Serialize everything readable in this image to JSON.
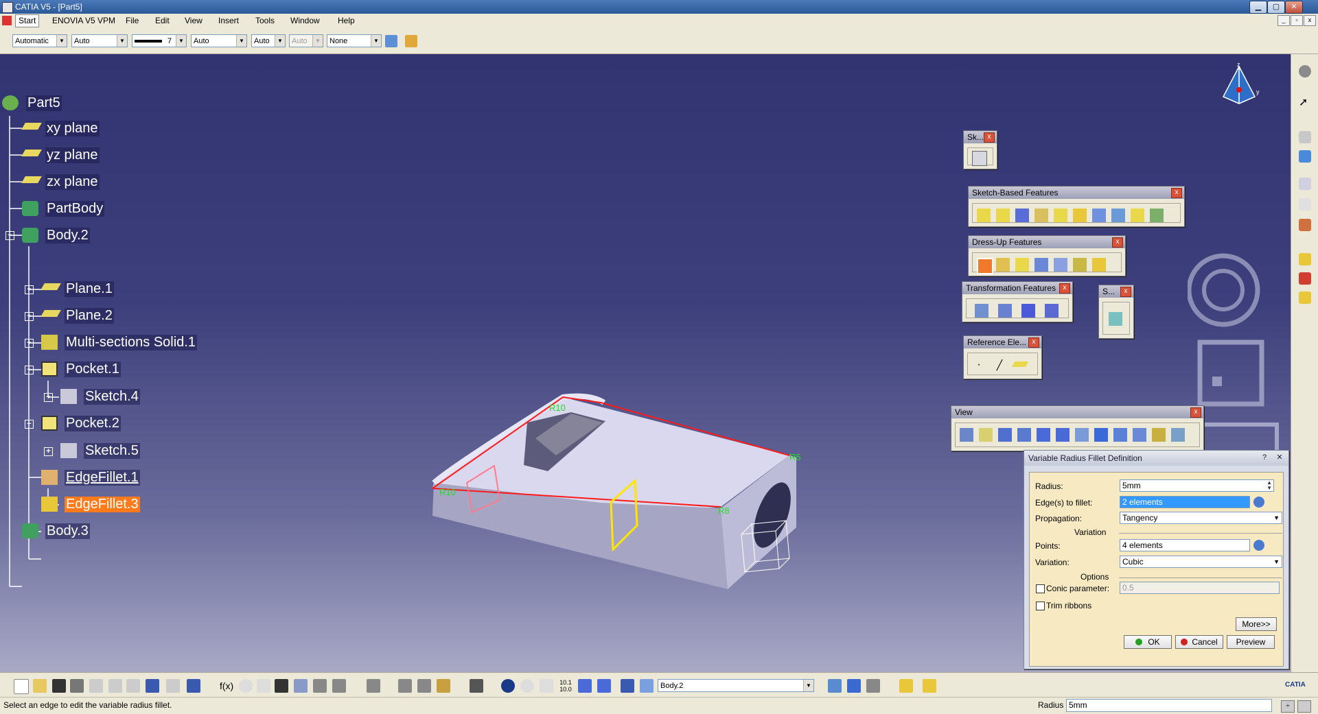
{
  "window": {
    "title": "CATIA V5 - [Part5]"
  },
  "menu": {
    "start": "Start",
    "items": [
      "ENOVIA V5 VPM",
      "File",
      "Edit",
      "View",
      "Insert",
      "Tools",
      "Window",
      "Help"
    ]
  },
  "properties": {
    "color": "Automatic",
    "fill": "Auto",
    "line_weight": "7",
    "line_type": "Auto",
    "point_type": "Auto",
    "transparency": "Auto",
    "layer": "None"
  },
  "tree": {
    "root": "Part5",
    "nodes": [
      "xy plane",
      "yz plane",
      "zx plane",
      "PartBody",
      "Body.2",
      "Plane.1",
      "Plane.2",
      "Multi-sections Solid.1",
      "Pocket.1",
      "Sketch.4",
      "Pocket.2",
      "Sketch.5",
      "EdgeFillet.1",
      "EdgeFillet.3",
      "Body.3"
    ]
  },
  "toolbars": {
    "sketcher": "Sk...",
    "sketch_based": "Sketch-Based Features",
    "dress_up": "Dress-Up Features",
    "transformation": "Transformation Features",
    "surface": "S...",
    "reference": "Reference Ele...",
    "view": "View"
  },
  "model_labels": {
    "r1": "R10",
    "r2": "R10",
    "r3": "R5",
    "r4": "R8"
  },
  "dialog": {
    "title": "Variable Radius Fillet Definition",
    "help": "?",
    "radius_label": "Radius:",
    "radius_value": "5mm",
    "edges_label": "Edge(s) to fillet:",
    "edges_value": "2 elements",
    "propagation_label": "Propagation:",
    "propagation_value": "Tangency",
    "variation_section": "Variation",
    "points_label": "Points:",
    "points_value": "4 elements",
    "variation_label": "Variation:",
    "variation_value": "Cubic",
    "options_section": "Options",
    "conic_label": "Conic parameter:",
    "conic_value": "0.5",
    "trim_label": "Trim ribbons",
    "more": "More>>",
    "ok": "OK",
    "cancel": "Cancel",
    "preview": "Preview"
  },
  "bottom": {
    "body_combo": "Body.2"
  },
  "status": {
    "message": "Select an edge to edit the variable radius fillet.",
    "radius_label": "Radius",
    "radius_value": "5mm"
  }
}
